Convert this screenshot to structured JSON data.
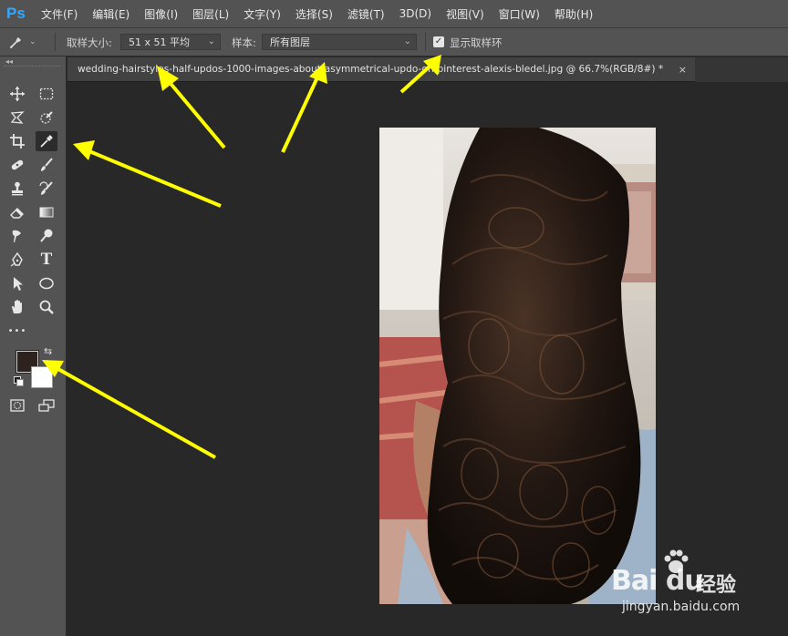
{
  "app": {
    "logo": "Ps"
  },
  "menu": [
    "文件(F)",
    "编辑(E)",
    "图像(I)",
    "图层(L)",
    "文字(Y)",
    "选择(S)",
    "滤镜(T)",
    "3D(D)",
    "视图(V)",
    "窗口(W)",
    "帮助(H)"
  ],
  "options": {
    "sample_size_label": "取样大小:",
    "sample_size_value": "51 x 51 平均",
    "sample_label": "样本:",
    "sample_value": "所有图层",
    "show_ring_label": "显示取样环",
    "show_ring_checked": true
  },
  "document": {
    "tab_title": "wedding-hairstyles-half-updos-1000-images-about-asymmetrical-updo-on-pinterest-alexis-bledel.jpg @ 66.7%(RGB/8#) *",
    "close_glyph": "×"
  },
  "toolbar": {
    "tools": [
      "move-icon",
      "marquee-icon",
      "lasso-icon",
      "quick-select-icon",
      "crop-icon",
      "eyedropper-icon",
      "healing-icon",
      "brush-icon",
      "stamp-icon",
      "history-brush-icon",
      "eraser-icon",
      "gradient-icon",
      "smudge-icon",
      "dodge-icon",
      "pen-icon",
      "type-icon",
      "path-select-icon",
      "ellipse-icon",
      "hand-icon",
      "zoom-icon",
      "more-icon"
    ],
    "active_tool": "eyedropper-icon",
    "type_tool_glyph": "T",
    "more_glyph": "•••",
    "foreground_color": "#2e221e",
    "background_color": "#ffffff"
  },
  "watermark": {
    "brand": "Bai du",
    "site": "经验",
    "url": "jingyan.baidu.com"
  },
  "colors": {
    "accent": "#31a8ff",
    "annotation_arrow": "#ffff00"
  }
}
